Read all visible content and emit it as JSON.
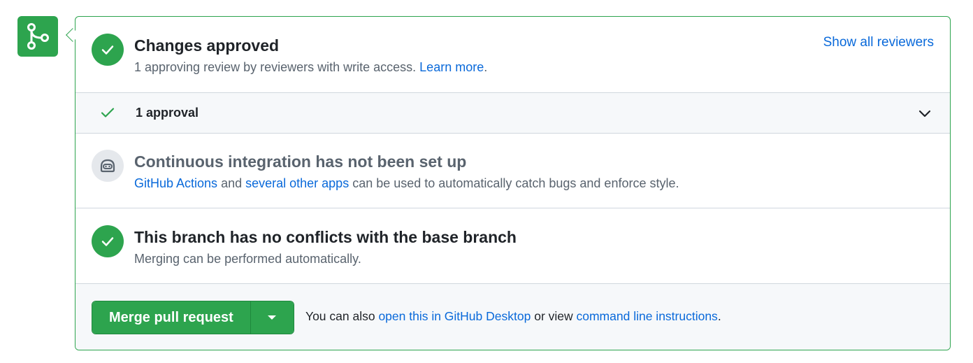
{
  "colors": {
    "success": "#2da44e",
    "link": "#0969da",
    "muted_text": "#59636e",
    "subtle_bg": "#f6f8fa"
  },
  "icons": {
    "timeline": "git-merge-icon",
    "review_status": "check-circle-icon",
    "approval": "check-icon",
    "approval_toggle": "chevron-down-icon",
    "ci": "robot-icon",
    "conflicts_status": "check-circle-icon",
    "merge_dropdown": "triangle-down-icon"
  },
  "review": {
    "title": "Changes approved",
    "description": "1 approving review by reviewers with write access.",
    "learn_more": "Learn more",
    "learn_more_suffix": ".",
    "show_all_reviewers": "Show all reviewers"
  },
  "approvals": {
    "label": "1 approval"
  },
  "ci": {
    "title": "Continuous integration has not been set up",
    "link_actions": "GitHub Actions",
    "text_and": " and ",
    "link_other_apps": "several other apps",
    "text_rest": " can be used to automatically catch bugs and enforce style."
  },
  "conflicts": {
    "title": "This branch has no conflicts with the base branch",
    "description": "Merging can be performed automatically."
  },
  "merge": {
    "button_label": "Merge pull request",
    "hint_prefix": "You can also ",
    "link_desktop": "open this in GitHub Desktop",
    "hint_middle": " or view ",
    "link_cli": "command line instructions",
    "hint_suffix": "."
  }
}
